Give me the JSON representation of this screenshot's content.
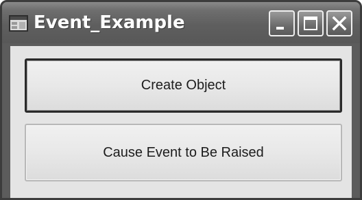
{
  "window": {
    "title": "Event_Example"
  },
  "title_bar": {
    "controls": [
      {
        "name": "minimize",
        "icon": "minimize-icon"
      },
      {
        "name": "maximize",
        "icon": "maximize-icon"
      },
      {
        "name": "close",
        "icon": "close-icon"
      }
    ]
  },
  "form": {
    "buttons": [
      {
        "label": "Create Object"
      },
      {
        "label": "Cause Event to Be Raised"
      }
    ]
  }
}
